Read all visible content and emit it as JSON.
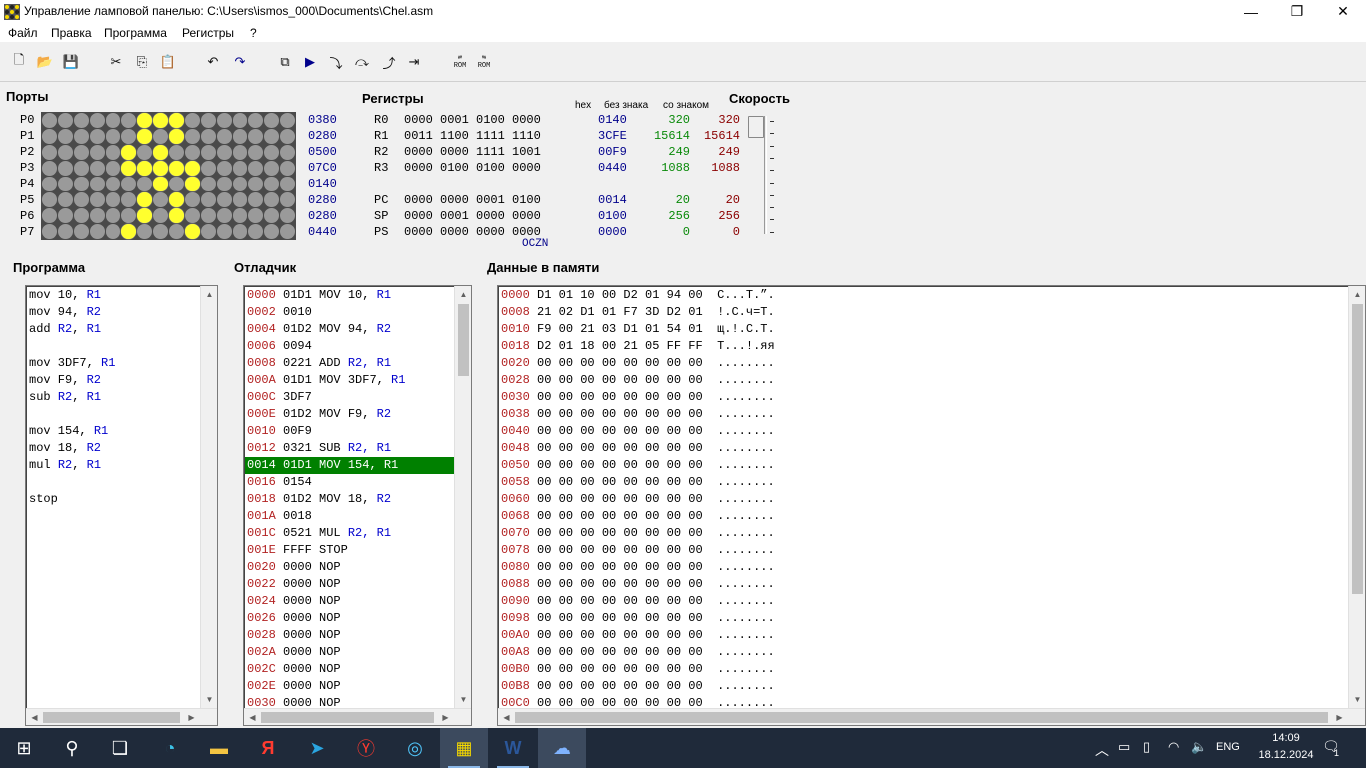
{
  "window": {
    "title": "Управление ламповой панелью: C:\\Users\\ismos_000\\Documents\\Chel.asm",
    "minimize": "—",
    "maximize": "❐",
    "close": "✕"
  },
  "menu": [
    "Файл",
    "Правка",
    "Программа",
    "Регистры",
    "?"
  ],
  "toolbar": {
    "icons": [
      "new-file-icon",
      "open-folder-icon",
      "save-icon",
      "cut-icon",
      "copy-icon",
      "paste-icon",
      "undo-icon",
      "redo-icon",
      "compile-icon",
      "run-icon",
      "step-into-icon",
      "step-over-icon",
      "step-out-icon",
      "run-to-cursor-icon",
      "load-rom-icon",
      "save-rom-icon"
    ],
    "rom_label": "ROM"
  },
  "ports": {
    "title": "Порты",
    "rows": [
      {
        "label": "P0",
        "hex": "0380"
      },
      {
        "label": "P1",
        "hex": "0280"
      },
      {
        "label": "P2",
        "hex": "0500"
      },
      {
        "label": "P3",
        "hex": "07C0"
      },
      {
        "label": "P4",
        "hex": "0140"
      },
      {
        "label": "P5",
        "hex": "0280"
      },
      {
        "label": "P6",
        "hex": "0280"
      },
      {
        "label": "P7",
        "hex": "0440"
      }
    ]
  },
  "registers": {
    "title": "Регистры",
    "headers": {
      "hex": "hex",
      "unsigned": "без знака",
      "signed": "со знаком"
    },
    "rows": [
      {
        "name": "R0",
        "bin": "0000 0001 0100 0000",
        "hex": "0140",
        "u": "320",
        "s": "320"
      },
      {
        "name": "R1",
        "bin": "0011 1100 1111 1110",
        "hex": "3CFE",
        "u": "15614",
        "s": "15614"
      },
      {
        "name": "R2",
        "bin": "0000 0000 1111 1001",
        "hex": "00F9",
        "u": "249",
        "s": "249"
      },
      {
        "name": "R3",
        "bin": "0000 0100 0100 0000",
        "hex": "0440",
        "u": "1088",
        "s": "1088"
      },
      {
        "name": "PC",
        "bin": "0000 0000 0001 0100",
        "hex": "0014",
        "u": "20",
        "s": "20"
      },
      {
        "name": "SP",
        "bin": "0000 0001 0000 0000",
        "hex": "0100",
        "u": "256",
        "s": "256"
      },
      {
        "name": "PS",
        "bin": "0000 0000 0000 0000",
        "hex": "0000",
        "u": "0",
        "s": "0"
      }
    ],
    "flags": "OCZN"
  },
  "speed": {
    "title": "Скорость",
    "level": 1.0
  },
  "program": {
    "title": "Программа",
    "lines": [
      [
        "mov 10, ",
        "R1"
      ],
      [
        "mov 94, ",
        "R2"
      ],
      [
        "add ",
        "R2",
        ", ",
        "R1"
      ],
      [
        ""
      ],
      [
        "mov 3DF7, ",
        "R1"
      ],
      [
        "mov F9, ",
        "R2"
      ],
      [
        "sub ",
        "R2",
        ", ",
        "R1"
      ],
      [
        ""
      ],
      [
        "mov 154, ",
        "R1"
      ],
      [
        "mov 18, ",
        "R2"
      ],
      [
        "mul ",
        "R2",
        ", ",
        "R1"
      ],
      [
        ""
      ],
      [
        "stop"
      ]
    ]
  },
  "debugger": {
    "title": "Отладчик",
    "selected": 10,
    "rows": [
      {
        "addr": "0000",
        "word": "01D1",
        "instr": "MOV 10, ",
        "reg": "R1"
      },
      {
        "addr": "0002",
        "word": "0010",
        "instr": "",
        "reg": ""
      },
      {
        "addr": "0004",
        "word": "01D2",
        "instr": "MOV 94, ",
        "reg": "R2"
      },
      {
        "addr": "0006",
        "word": "0094",
        "instr": "",
        "reg": ""
      },
      {
        "addr": "0008",
        "word": "0221",
        "instr": "ADD ",
        "reg": "R2, R1"
      },
      {
        "addr": "000A",
        "word": "01D1",
        "instr": "MOV 3DF7, ",
        "reg": "R1"
      },
      {
        "addr": "000C",
        "word": "3DF7",
        "instr": "",
        "reg": ""
      },
      {
        "addr": "000E",
        "word": "01D2",
        "instr": "MOV F9, ",
        "reg": "R2"
      },
      {
        "addr": "0010",
        "word": "00F9",
        "instr": "",
        "reg": ""
      },
      {
        "addr": "0012",
        "word": "0321",
        "instr": "SUB ",
        "reg": "R2, R1"
      },
      {
        "addr": "0014",
        "word": "01D1",
        "instr": "MOV 154, ",
        "reg": "R1"
      },
      {
        "addr": "0016",
        "word": "0154",
        "instr": "",
        "reg": ""
      },
      {
        "addr": "0018",
        "word": "01D2",
        "instr": "MOV 18, ",
        "reg": "R2"
      },
      {
        "addr": "001A",
        "word": "0018",
        "instr": "",
        "reg": ""
      },
      {
        "addr": "001C",
        "word": "0521",
        "instr": "MUL ",
        "reg": "R2, R1"
      },
      {
        "addr": "001E",
        "word": "FFFF",
        "instr": "STOP",
        "reg": ""
      },
      {
        "addr": "0020",
        "word": "0000",
        "instr": "NOP",
        "reg": ""
      },
      {
        "addr": "0022",
        "word": "0000",
        "instr": "NOP",
        "reg": ""
      },
      {
        "addr": "0024",
        "word": "0000",
        "instr": "NOP",
        "reg": ""
      },
      {
        "addr": "0026",
        "word": "0000",
        "instr": "NOP",
        "reg": ""
      },
      {
        "addr": "0028",
        "word": "0000",
        "instr": "NOP",
        "reg": ""
      },
      {
        "addr": "002A",
        "word": "0000",
        "instr": "NOP",
        "reg": ""
      },
      {
        "addr": "002C",
        "word": "0000",
        "instr": "NOP",
        "reg": ""
      },
      {
        "addr": "002E",
        "word": "0000",
        "instr": "NOP",
        "reg": ""
      },
      {
        "addr": "0030",
        "word": "0000",
        "instr": "NOP",
        "reg": ""
      }
    ]
  },
  "memory": {
    "title": "Данные в памяти",
    "rows": [
      {
        "addr": "0000",
        "bytes": "D1 01 10 00 D2 01 94 00",
        "ascii": "С...Т.”."
      },
      {
        "addr": "0008",
        "bytes": "21 02 D1 01 F7 3D D2 01",
        "ascii": "!.С.ч=Т."
      },
      {
        "addr": "0010",
        "bytes": "F9 00 21 03 D1 01 54 01",
        "ascii": "щ.!.С.Т."
      },
      {
        "addr": "0018",
        "bytes": "D2 01 18 00 21 05 FF FF",
        "ascii": "Т...!.яя"
      },
      {
        "addr": "0020",
        "bytes": "00 00 00 00 00 00 00 00",
        "ascii": "........"
      },
      {
        "addr": "0028",
        "bytes": "00 00 00 00 00 00 00 00",
        "ascii": "........"
      },
      {
        "addr": "0030",
        "bytes": "00 00 00 00 00 00 00 00",
        "ascii": "........"
      },
      {
        "addr": "0038",
        "bytes": "00 00 00 00 00 00 00 00",
        "ascii": "........"
      },
      {
        "addr": "0040",
        "bytes": "00 00 00 00 00 00 00 00",
        "ascii": "........"
      },
      {
        "addr": "0048",
        "bytes": "00 00 00 00 00 00 00 00",
        "ascii": "........"
      },
      {
        "addr": "0050",
        "bytes": "00 00 00 00 00 00 00 00",
        "ascii": "........"
      },
      {
        "addr": "0058",
        "bytes": "00 00 00 00 00 00 00 00",
        "ascii": "........"
      },
      {
        "addr": "0060",
        "bytes": "00 00 00 00 00 00 00 00",
        "ascii": "........"
      },
      {
        "addr": "0068",
        "bytes": "00 00 00 00 00 00 00 00",
        "ascii": "........"
      },
      {
        "addr": "0070",
        "bytes": "00 00 00 00 00 00 00 00",
        "ascii": "........"
      },
      {
        "addr": "0078",
        "bytes": "00 00 00 00 00 00 00 00",
        "ascii": "........"
      },
      {
        "addr": "0080",
        "bytes": "00 00 00 00 00 00 00 00",
        "ascii": "........"
      },
      {
        "addr": "0088",
        "bytes": "00 00 00 00 00 00 00 00",
        "ascii": "........"
      },
      {
        "addr": "0090",
        "bytes": "00 00 00 00 00 00 00 00",
        "ascii": "........"
      },
      {
        "addr": "0098",
        "bytes": "00 00 00 00 00 00 00 00",
        "ascii": "........"
      },
      {
        "addr": "00A0",
        "bytes": "00 00 00 00 00 00 00 00",
        "ascii": "........"
      },
      {
        "addr": "00A8",
        "bytes": "00 00 00 00 00 00 00 00",
        "ascii": "........"
      },
      {
        "addr": "00B0",
        "bytes": "00 00 00 00 00 00 00 00",
        "ascii": "........"
      },
      {
        "addr": "00B8",
        "bytes": "00 00 00 00 00 00 00 00",
        "ascii": "........"
      },
      {
        "addr": "00C0",
        "bytes": "00 00 00 00 00 00 00 00",
        "ascii": "........"
      }
    ]
  },
  "taskbar": {
    "icons": [
      "windows-start-icon",
      "search-icon",
      "task-view-icon",
      "edge-icon",
      "file-explorer-icon",
      "yandex-icon",
      "telegram-icon",
      "yandex-browser-icon",
      "settings-app-icon",
      "lamp-panel-app-icon",
      "word-icon",
      "notes-app-icon"
    ],
    "lang": "ENG",
    "time": "14:09",
    "date": "18.12.2024",
    "notifications": "1"
  },
  "colors": {
    "accent_select": "#008000",
    "lamp_on": "#ffff2e",
    "lamp_off": "#9a9a9a",
    "hex_blue": "#00008b",
    "unsigned_green": "#0a8a0a",
    "signed_red": "#8b0000",
    "address_red": "#b22222",
    "register_blue": "#0000cd"
  }
}
